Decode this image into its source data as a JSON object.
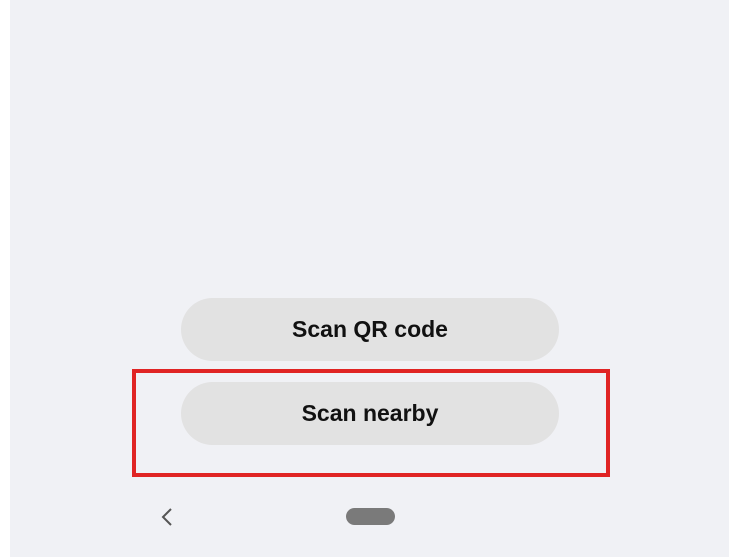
{
  "actions": {
    "scan_qr_label": "Scan QR code",
    "scan_nearby_label": "Scan nearby"
  },
  "navbar": {
    "back_icon": "chevron-left-icon",
    "home_icon": "home-pill-icon"
  },
  "colors": {
    "background": "#f0f1f5",
    "button_bg": "#e2e2e2",
    "highlight": "#e02424"
  }
}
